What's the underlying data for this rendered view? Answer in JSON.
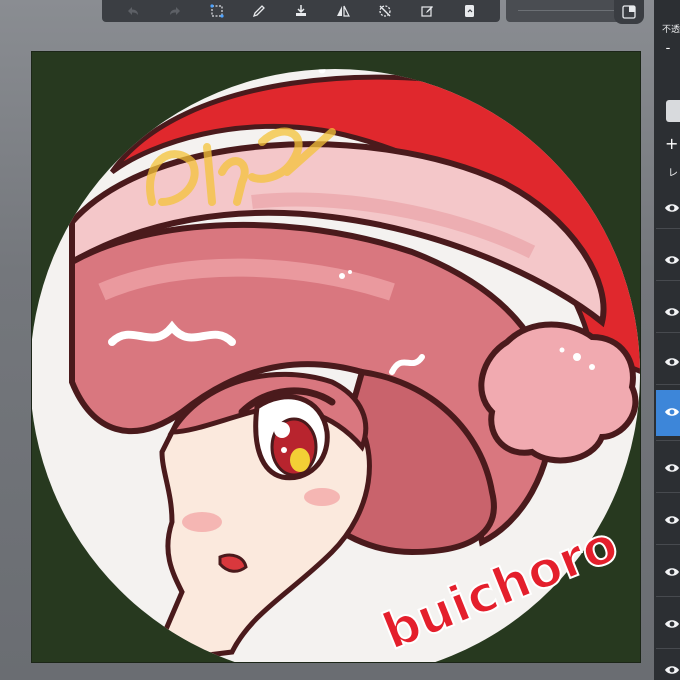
{
  "toolbar": {
    "icons": [
      "undo-icon",
      "redo-icon",
      "transform-icon",
      "pen-icon",
      "fill-icon",
      "flip-icon",
      "no-select-icon",
      "edit-icon",
      "copy-icon"
    ]
  },
  "panel": {
    "opacity_label": "不透",
    "minus_label": "-",
    "plus_label": "+",
    "layer_label": "レ"
  },
  "artwork": {
    "signature": "buichoro",
    "corner_doodle": "Clck!",
    "colors": {
      "background": "#27391f",
      "hat_red": "#e0282d",
      "hat_brim": "#f4c7c9",
      "hair": "#d9777f",
      "skin": "#fbe9dd",
      "outline": "#4a1a1c",
      "signature": "#e41f2c",
      "doodle": "#f4c33a",
      "pompom": "#f1aab0"
    }
  }
}
